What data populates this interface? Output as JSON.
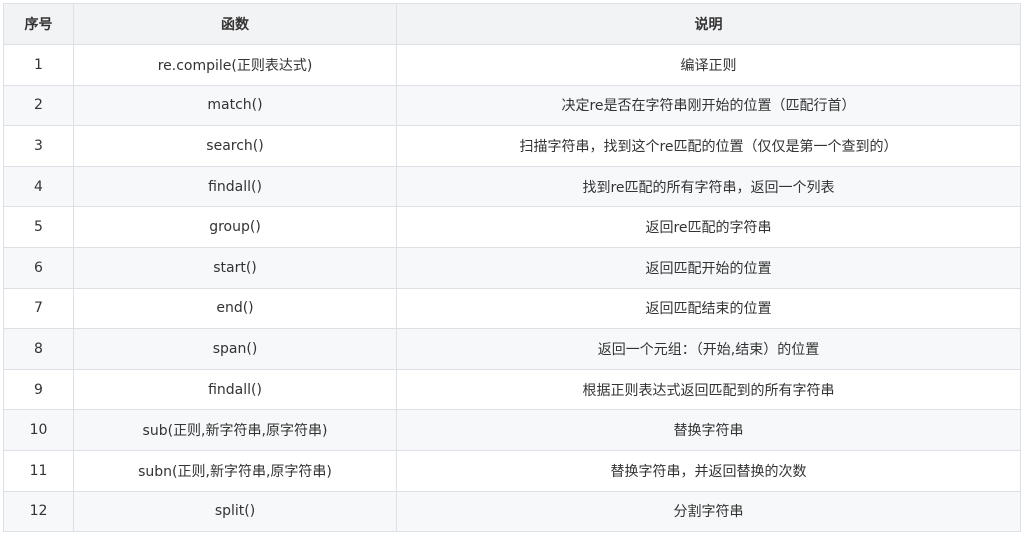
{
  "table": {
    "headers": [
      "序号",
      "函数",
      "说明"
    ],
    "rows": [
      {
        "index": "1",
        "func": "re.compile(正则表达式)",
        "desc": "编译正则"
      },
      {
        "index": "2",
        "func": "match()",
        "desc": "决定re是否在字符串刚开始的位置（匹配行首）"
      },
      {
        "index": "3",
        "func": "search()",
        "desc": "扫描字符串，找到这个re匹配的位置（仅仅是第一个查到的）"
      },
      {
        "index": "4",
        "func": "findall()",
        "desc": "找到re匹配的所有字符串，返回一个列表"
      },
      {
        "index": "5",
        "func": "group()",
        "desc": "返回re匹配的字符串"
      },
      {
        "index": "6",
        "func": "start()",
        "desc": "返回匹配开始的位置"
      },
      {
        "index": "7",
        "func": "end()",
        "desc": "返回匹配结束的位置"
      },
      {
        "index": "8",
        "func": "span()",
        "desc": "返回一个元组：（开始,结束）的位置"
      },
      {
        "index": "9",
        "func": "findall()",
        "desc": "根据正则表达式返回匹配到的所有字符串"
      },
      {
        "index": "10",
        "func": "sub(正则,新字符串,原字符串)",
        "desc": "替换字符串"
      },
      {
        "index": "11",
        "func": "subn(正则,新字符串,原字符串)",
        "desc": "替换字符串，并返回替换的次数"
      },
      {
        "index": "12",
        "func": "split()",
        "desc": "分割字符串"
      }
    ]
  }
}
